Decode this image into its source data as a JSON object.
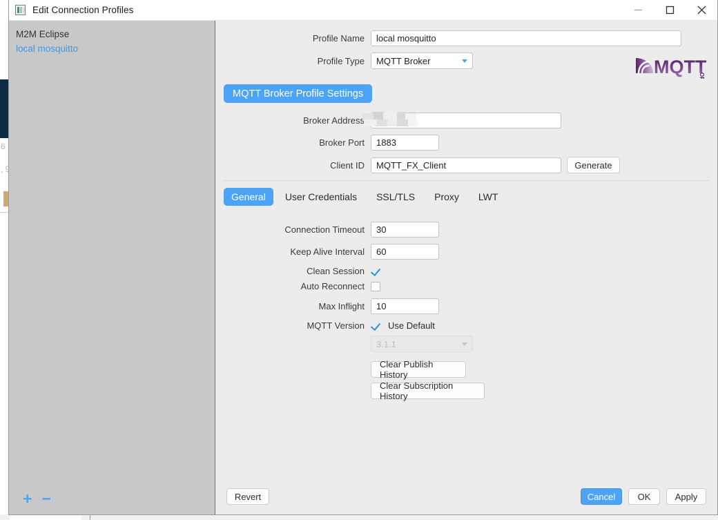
{
  "window": {
    "title": "Edit Connection Profiles",
    "icon": "app-icon",
    "controls": {
      "minimize": "—",
      "maximize": "☐",
      "close": "✕"
    }
  },
  "sidebar": {
    "items": [
      {
        "label": "M2M Eclipse",
        "selected": false
      },
      {
        "label": "local mosquitto",
        "selected": true
      }
    ],
    "tools": {
      "add": "+",
      "remove": "−"
    }
  },
  "profile": {
    "name_label": "Profile Name",
    "name_value": "local mosquitto",
    "type_label": "Profile Type",
    "type_value": "MQTT Broker"
  },
  "logo": {
    "text": "MQTT",
    "suffix": "ORG"
  },
  "section": {
    "title": "MQTT Broker Profile Settings"
  },
  "broker": {
    "address_label": "Broker Address",
    "address_value": "",
    "port_label": "Broker Port",
    "port_value": "1883",
    "client_id_label": "Client ID",
    "client_id_value": "MQTT_FX_Client",
    "generate_label": "Generate"
  },
  "tabs": [
    {
      "label": "General",
      "active": true
    },
    {
      "label": "User Credentials",
      "active": false
    },
    {
      "label": "SSL/TLS",
      "active": false
    },
    {
      "label": "Proxy",
      "active": false
    },
    {
      "label": "LWT",
      "active": false
    }
  ],
  "general": {
    "connection_timeout_label": "Connection Timeout",
    "connection_timeout_value": "30",
    "keep_alive_label": "Keep Alive Interval",
    "keep_alive_value": "60",
    "clean_session_label": "Clean Session",
    "clean_session_checked": true,
    "auto_reconnect_label": "Auto Reconnect",
    "auto_reconnect_checked": false,
    "max_inflight_label": "Max Inflight",
    "max_inflight_value": "10",
    "mqtt_version_label": "MQTT Version",
    "use_default_label": "Use Default",
    "use_default_checked": true,
    "version_value": "3.1.1",
    "clear_publish_label": "Clear Publish History",
    "clear_subscription_label": "Clear Subscription History"
  },
  "footer": {
    "revert_label": "Revert",
    "cancel_label": "Cancel",
    "ok_label": "OK",
    "apply_label": "Apply"
  },
  "background": {
    "text_a": "6",
    "text_b": ", 9"
  },
  "colors": {
    "accent": "#4da3f5",
    "sidebar": "#c8c8c8",
    "content": "#ececec",
    "link": "#3d9ae8"
  }
}
